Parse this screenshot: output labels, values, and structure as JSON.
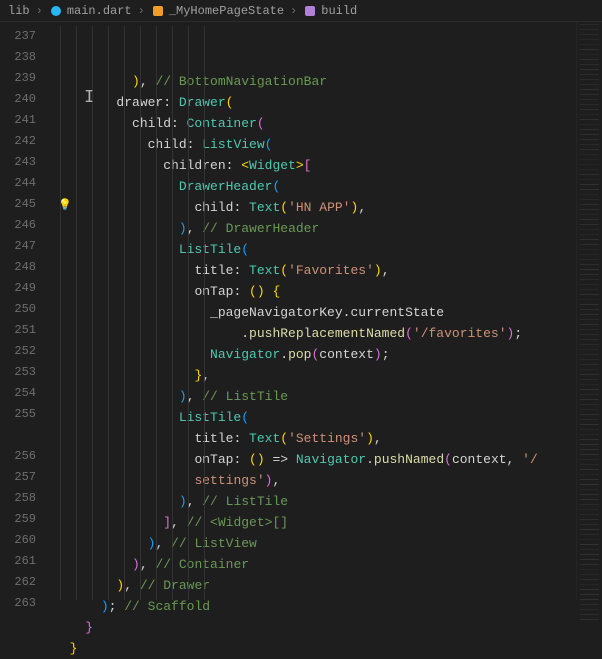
{
  "breadcrumb": {
    "items": [
      "lib",
      "main.dart",
      "_MyHomePageState",
      "build"
    ]
  },
  "gutter": {
    "start": 237,
    "end": 263,
    "lightbulb_line": 245
  },
  "colors": {
    "background": "#1e1e1e",
    "gutter": "#6e6e6e",
    "comment": "#6a9955",
    "class": "#4ec9b0",
    "func": "#dcdcaa",
    "string": "#ce9178",
    "param": "#9cdcfe",
    "lightbulb": "#ffcc00"
  },
  "code": {
    "237": [
      [
        "          "
      ],
      [
        ")",
        1
      ],
      [
        ", ",
        0
      ],
      [
        "// BottomNavigationBar",
        "c"
      ]
    ],
    "238": [
      [
        "        "
      ],
      [
        "drawer: ",
        0
      ],
      [
        "Drawer",
        "cl"
      ],
      [
        "(",
        1
      ]
    ],
    "239": [
      [
        "          "
      ],
      [
        "child: ",
        0
      ],
      [
        "Container",
        "cl"
      ],
      [
        "(",
        2
      ]
    ],
    "240": [
      [
        "            "
      ],
      [
        "child: ",
        0
      ],
      [
        "ListView",
        "cl"
      ],
      [
        "(",
        3
      ]
    ],
    "241": [
      [
        "              "
      ],
      [
        "children: ",
        0
      ],
      [
        "<",
        1
      ],
      [
        "Widget",
        "cl"
      ],
      [
        ">",
        1
      ],
      [
        "[",
        2
      ]
    ],
    "242": [
      [
        "                "
      ],
      [
        "DrawerHeader",
        "cl"
      ],
      [
        "(",
        3
      ]
    ],
    "243": [
      [
        "                  "
      ],
      [
        "child: ",
        0
      ],
      [
        "Text",
        "cl"
      ],
      [
        "(",
        1
      ],
      [
        "'HN APP'",
        "s"
      ],
      [
        ")",
        1
      ],
      [
        ",",
        0
      ]
    ],
    "244": [
      [
        "                "
      ],
      [
        ")",
        3
      ],
      [
        ", ",
        0
      ],
      [
        "// DrawerHeader",
        "c"
      ]
    ],
    "245": [
      [
        "                "
      ],
      [
        "ListTile",
        "cl"
      ],
      [
        "(",
        3
      ]
    ],
    "246": [
      [
        "                  "
      ],
      [
        "title: ",
        0
      ],
      [
        "Text",
        "cl"
      ],
      [
        "(",
        1
      ],
      [
        "'Favorites'",
        "s"
      ],
      [
        ")",
        1
      ],
      [
        ",",
        0
      ]
    ],
    "247": [
      [
        "                  "
      ],
      [
        "onTap: ",
        0
      ],
      [
        "(",
        1
      ],
      [
        ") ",
        1
      ],
      [
        "{",
        1
      ]
    ],
    "248": [
      [
        "                    "
      ],
      [
        "_pageNavigatorKey",
        0
      ],
      [
        ".",
        0
      ],
      [
        "currentState",
        0
      ]
    ],
    "249": [
      [
        "                        "
      ],
      [
        ".",
        0
      ],
      [
        "pushReplacementNamed",
        "fn"
      ],
      [
        "(",
        2
      ],
      [
        "'/favorites'",
        "s"
      ],
      [
        ")",
        2
      ],
      [
        ";",
        0
      ]
    ],
    "250": [
      [
        "                    "
      ],
      [
        "Navigator",
        "cl"
      ],
      [
        ".",
        0
      ],
      [
        "pop",
        "fn"
      ],
      [
        "(",
        2
      ],
      [
        "context",
        0
      ],
      [
        ")",
        2
      ],
      [
        ";",
        0
      ]
    ],
    "251": [
      [
        "                  "
      ],
      [
        "}",
        1
      ],
      [
        ",",
        0
      ]
    ],
    "252": [
      [
        "                "
      ],
      [
        ")",
        3
      ],
      [
        ", ",
        0
      ],
      [
        "// ListTile",
        "c"
      ]
    ],
    "253": [
      [
        "                "
      ],
      [
        "ListTile",
        "cl"
      ],
      [
        "(",
        3
      ]
    ],
    "254": [
      [
        "                  "
      ],
      [
        "title: ",
        0
      ],
      [
        "Text",
        "cl"
      ],
      [
        "(",
        1
      ],
      [
        "'Settings'",
        "s"
      ],
      [
        ")",
        1
      ],
      [
        ",",
        0
      ]
    ],
    "255a": [
      [
        "                  "
      ],
      [
        "onTap: ",
        0
      ],
      [
        "(",
        1
      ],
      [
        ") ",
        1
      ],
      [
        "=> ",
        0
      ],
      [
        "Navigator",
        "cl"
      ],
      [
        ".",
        0
      ],
      [
        "pushNamed",
        "fn"
      ],
      [
        "(",
        2
      ],
      [
        "context",
        0
      ],
      [
        ", ",
        0
      ],
      [
        "'/",
        "s"
      ]
    ],
    "255b": [
      [
        "                  "
      ],
      [
        "settings'",
        "s"
      ],
      [
        ")",
        2
      ],
      [
        ",",
        0
      ]
    ],
    "256": [
      [
        "                "
      ],
      [
        ")",
        3
      ],
      [
        ", ",
        0
      ],
      [
        "// ListTile",
        "c"
      ]
    ],
    "257": [
      [
        "              "
      ],
      [
        "]",
        2
      ],
      [
        ", ",
        0
      ],
      [
        "// <Widget>[]",
        "c"
      ]
    ],
    "258": [
      [
        "            "
      ],
      [
        ")",
        3
      ],
      [
        ", ",
        0
      ],
      [
        "// ListView",
        "c"
      ]
    ],
    "259": [
      [
        "          "
      ],
      [
        ")",
        2
      ],
      [
        ", ",
        0
      ],
      [
        "// Container",
        "c"
      ]
    ],
    "260": [
      [
        "        "
      ],
      [
        ")",
        1
      ],
      [
        ", ",
        0
      ],
      [
        "// Drawer",
        "c"
      ]
    ],
    "261": [
      [
        "      "
      ],
      [
        ")",
        3
      ],
      [
        "; ",
        0
      ],
      [
        "// Scaffold",
        "c"
      ]
    ],
    "262": [
      [
        "    "
      ],
      [
        "}",
        2
      ]
    ],
    "263": [
      [
        "  "
      ],
      [
        "}",
        1
      ]
    ]
  },
  "indent_guides": [
    6,
    22,
    38,
    54,
    70,
    86,
    102,
    118,
    134,
    150
  ],
  "line_order": [
    "237",
    "238",
    "239",
    "240",
    "241",
    "242",
    "243",
    "244",
    "245",
    "246",
    "247",
    "248",
    "249",
    "250",
    "251",
    "252",
    "253",
    "254",
    "255a",
    "255b",
    "256",
    "257",
    "258",
    "259",
    "260",
    "261",
    "262",
    "263"
  ],
  "line_numbers": [
    "237",
    "238",
    "239",
    "240",
    "241",
    "242",
    "243",
    "244",
    "245",
    "246",
    "247",
    "248",
    "249",
    "250",
    "251",
    "252",
    "253",
    "254",
    "255",
    "",
    "256",
    "257",
    "258",
    "259",
    "260",
    "261",
    "262",
    "263"
  ]
}
